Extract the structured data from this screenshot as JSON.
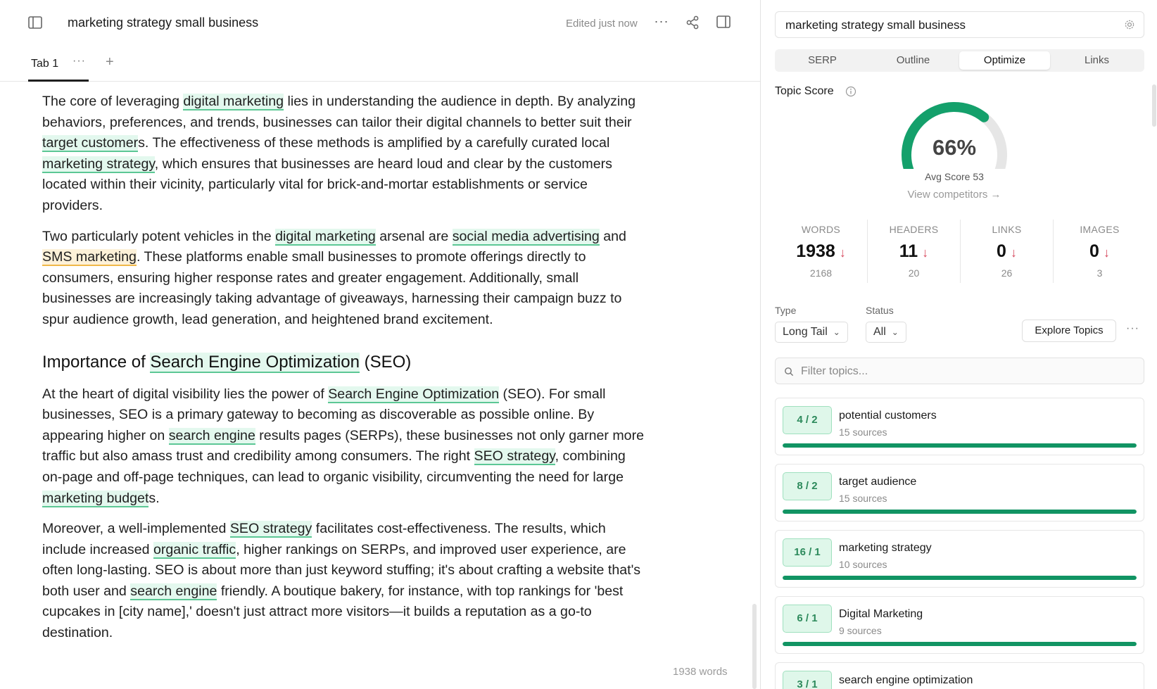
{
  "header": {
    "doc_title": "marketing strategy small business",
    "edited_status": "Edited just now",
    "more_label": "···"
  },
  "tabs": {
    "active_label": "Tab 1",
    "dots_label": "···",
    "add_label": "+"
  },
  "content": {
    "p1": [
      {
        "t": "The core of leveraging "
      },
      {
        "t": "digital marketing",
        "h": "g"
      },
      {
        "t": " lies in understanding the audience in depth. By analyzing behaviors, preferences, and trends, businesses can tailor their digital channels to better suit their "
      },
      {
        "t": "target customer",
        "h": "g"
      },
      {
        "t": "s. The effectiveness of these methods is amplified by a carefully curated local "
      },
      {
        "t": "marketing strategy",
        "h": "g"
      },
      {
        "t": ", which ensures that businesses are heard loud and clear by the customers located within their vicinity, particularly vital for brick-and-mortar establishments or service providers."
      }
    ],
    "p2": [
      {
        "t": "Two particularly potent vehicles in the "
      },
      {
        "t": "digital marketing",
        "h": "g"
      },
      {
        "t": " arsenal are "
      },
      {
        "t": "social media advertising",
        "h": "g"
      },
      {
        "t": " and "
      },
      {
        "t": "SMS marketing",
        "h": "y"
      },
      {
        "t": ". These platforms enable small businesses to promote offerings directly to consumers, ensuring higher response rates and greater engagement. Additionally, small businesses are increasingly taking advantage of giveaways, harnessing their campaign buzz to spur audience growth, lead generation, and heightened brand excitement."
      }
    ],
    "h2": [
      {
        "t": "Importance of "
      },
      {
        "t": "Search Engine Optimization",
        "h": "g"
      },
      {
        "t": " (SEO)"
      }
    ],
    "p3": [
      {
        "t": "At the heart of digital visibility lies the power of "
      },
      {
        "t": "Search Engine Optimization",
        "h": "g"
      },
      {
        "t": " (SEO). For small businesses, SEO is a primary gateway to becoming as discoverable as possible online. By appearing higher on "
      },
      {
        "t": "search engine",
        "h": "g"
      },
      {
        "t": " results pages (SERPs), these businesses not only garner more traffic but also amass trust and credibility among consumers. The right "
      },
      {
        "t": "SEO strategy",
        "h": "g"
      },
      {
        "t": ", combining on-page and off-page techniques, can lead to organic visibility, circumventing the need for large "
      },
      {
        "t": "marketing budget",
        "h": "g"
      },
      {
        "t": "s."
      }
    ],
    "p4": [
      {
        "t": "Moreover, a well-implemented "
      },
      {
        "t": "SEO strategy",
        "h": "g"
      },
      {
        "t": " facilitates cost-effectiveness. The results, which include increased "
      },
      {
        "t": "organic traffic",
        "h": "g"
      },
      {
        "t": ", higher rankings on SERPs, and improved user experience, are often long-lasting. SEO is about more than just keyword stuffing; it's about crafting a website that's both user and "
      },
      {
        "t": "search engine",
        "h": "g"
      },
      {
        "t": " friendly. A boutique bakery, for instance, with top rankings for 'best cupcakes in [city name],' doesn't just attract more visitors—it builds a reputation as a go-to destination."
      }
    ]
  },
  "footer": {
    "word_count": "1938 words"
  },
  "panel": {
    "keyword": "marketing strategy small business",
    "segments": [
      "SERP",
      "Outline",
      "Optimize",
      "Links"
    ],
    "active_segment": 2,
    "topic_score_label": "Topic Score",
    "score_display": "66%",
    "score_fraction": 0.66,
    "avg_score": "Avg Score 53",
    "view_competitors": "View competitors →",
    "stats": [
      {
        "label": "WORDS",
        "value": "1938",
        "target": "2168"
      },
      {
        "label": "HEADERS",
        "value": "11",
        "target": "20"
      },
      {
        "label": "LINKS",
        "value": "0",
        "target": "26"
      },
      {
        "label": "IMAGES",
        "value": "0",
        "target": "3"
      }
    ],
    "stat_arrow": "↓",
    "type_label": "Type",
    "type_value": "Long Tail",
    "status_label": "Status",
    "status_value": "All",
    "explore_label": "Explore Topics",
    "more_label": "···",
    "filter_placeholder": "Filter topics...",
    "topics": [
      {
        "badge": "4 / 2",
        "name": "potential customers",
        "sources": "15 sources",
        "progress": 1.0
      },
      {
        "badge": "8 / 2",
        "name": "target audience",
        "sources": "15 sources",
        "progress": 1.0
      },
      {
        "badge": "16 / 1",
        "name": "marketing strategy",
        "sources": "10 sources",
        "progress": 1.0
      },
      {
        "badge": "6 / 1",
        "name": "Digital Marketing",
        "sources": "9 sources",
        "progress": 1.0
      },
      {
        "badge": "3 / 1",
        "name": "search engine optimization",
        "sources": "",
        "progress": 1.0
      }
    ],
    "colors": {
      "accent": "#119463",
      "badge_bg": "#dff7ea",
      "arrow": "#d6465b"
    }
  }
}
